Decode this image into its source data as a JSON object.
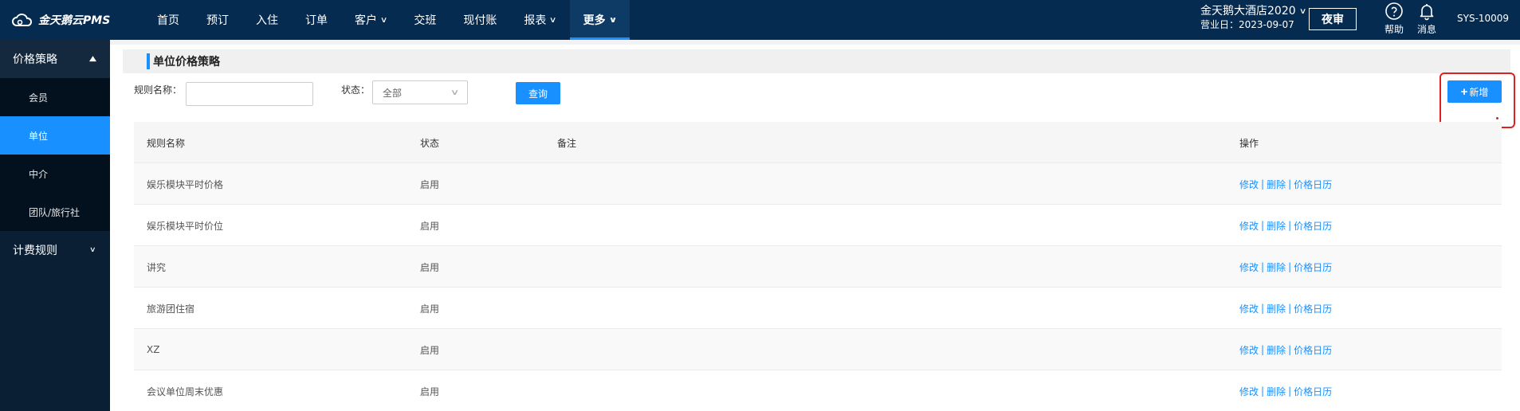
{
  "app": {
    "logo_text": "金天鹅云PMS",
    "accent": "#1890ff",
    "topbar_color": "#062b50"
  },
  "nav": {
    "items": [
      {
        "label": "首页",
        "dropdown": false
      },
      {
        "label": "预订",
        "dropdown": false
      },
      {
        "label": "入住",
        "dropdown": false
      },
      {
        "label": "订单",
        "dropdown": false
      },
      {
        "label": "客户",
        "dropdown": true
      },
      {
        "label": "交班",
        "dropdown": false
      },
      {
        "label": "现付账",
        "dropdown": false
      },
      {
        "label": "报表",
        "dropdown": true
      },
      {
        "label": "更多",
        "dropdown": true,
        "active": true
      }
    ],
    "chevron": "∨"
  },
  "header_right": {
    "hotel_name": "金天鹅大酒店2020",
    "business_date": "营业日：2023-09-07",
    "night_audit": "夜审",
    "help": "帮助",
    "messages": "消息",
    "user": "SYS-10009"
  },
  "sidebar": {
    "groups": [
      {
        "label": "价格策略",
        "expanded": true,
        "caret": "▲"
      },
      {
        "label": "计费规则",
        "expanded": false,
        "caret": "∨"
      }
    ],
    "items": [
      {
        "label": "会员"
      },
      {
        "label": "单位",
        "active": true
      },
      {
        "label": "中介"
      },
      {
        "label": "团队/旅行社"
      }
    ]
  },
  "page": {
    "title": "单位价格策略"
  },
  "filters": {
    "rule_name_label": "规则名称：",
    "rule_name_value": "",
    "status_label": "状态：",
    "status_value": "全部",
    "query": "查询",
    "add": "新增",
    "add_plus": "+"
  },
  "table": {
    "headers": {
      "name": "规则名称",
      "status": "状态",
      "note": "备注",
      "ops": "操作"
    },
    "ops_labels": {
      "edit": "修改",
      "delete": "删除",
      "calendar": "价格日历",
      "sep": "|"
    },
    "rows": [
      {
        "name": "娱乐模块平时价格",
        "status": "启用",
        "note": ""
      },
      {
        "name": "娱乐模块平时价位",
        "status": "启用",
        "note": ""
      },
      {
        "name": "讲究",
        "status": "启用",
        "note": ""
      },
      {
        "name": "旅游团住宿",
        "status": "启用",
        "note": ""
      },
      {
        "name": "XZ",
        "status": "启用",
        "note": ""
      },
      {
        "name": "会议单位周末优惠",
        "status": "启用",
        "note": ""
      }
    ]
  }
}
